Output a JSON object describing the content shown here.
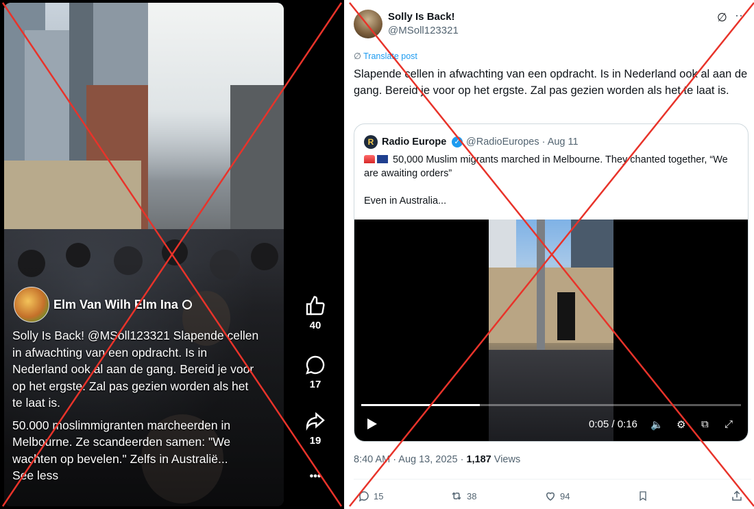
{
  "left": {
    "author_name": "Elm Van Wilh Elm Ina",
    "caption_p1": "Solly Is Back! @MSoll123321 Slapende cellen in afwachting van een opdracht. Is in Nederland ook al aan de gang. Bereid je voor op het ergste. Zal pas gezien worden als het te laat is.",
    "caption_p2": "50.000 moslimmigranten marcheerden in Melbourne. Ze scandeerden samen: \"We wachten op bevelen.\" Zelfs in Australië...",
    "see_less": "See less",
    "likes": "40",
    "comments": "17",
    "shares": "19",
    "more": "•••"
  },
  "post": {
    "author_name": "Solly Is Back!",
    "author_handle": "@MSoll123321",
    "translate": "Translate post",
    "text": "Slapende cellen in afwachting van een opdracht. Is in Nederland ook al aan de gang. Bereid je voor op het ergste. Zal pas gezien worden als het te laat is.",
    "time": "8:40 AM · Aug 13, 2025 · ",
    "views_count": "1,187",
    "views_label": " Views",
    "replies": "15",
    "reposts": "38",
    "likes": "94"
  },
  "quote": {
    "avatar_letter": "R",
    "name": "Radio Europe",
    "verified": "✓",
    "handle_date": "@RadioEuropes · Aug 11",
    "line1": "50,000 Muslim migrants marched in Melbourne. They chanted together, “We are awaiting orders”",
    "line2": "Even in Australia...",
    "video_time": "0:05 / 0:16",
    "progress": 0.3125
  },
  "colors": {
    "cross": "#e8332a",
    "link": "#1d9bf0"
  }
}
